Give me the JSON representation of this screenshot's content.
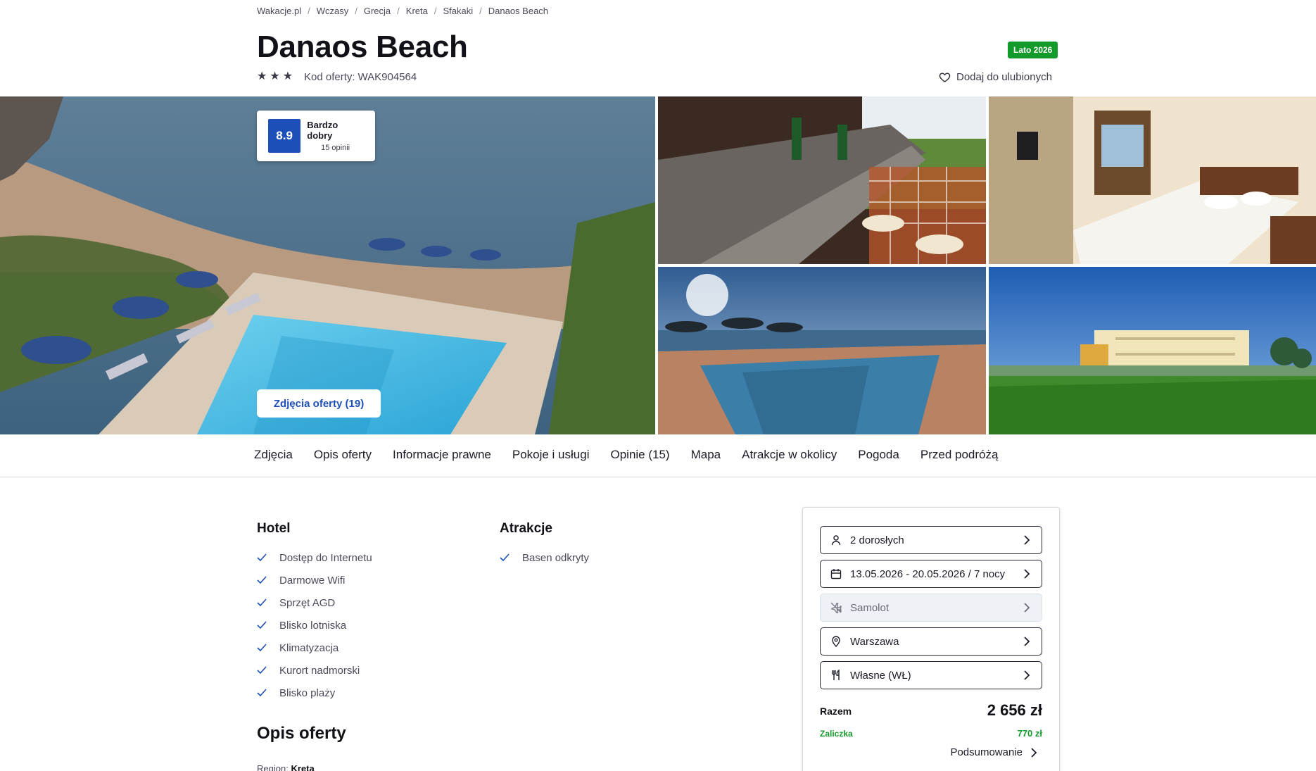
{
  "breadcrumb": [
    "Wakacje.pl",
    "Wczasy",
    "Grecja",
    "Kreta",
    "Sfakaki",
    "Danaos Beach"
  ],
  "breadcrumb_separator": "/",
  "hotel": {
    "name": "Danaos Beach",
    "stars": 3,
    "offer_code_label": "Kod oferty:",
    "offer_code": "WAK904564",
    "season_badge": "Lato 2026",
    "favorite_label": "Dodaj do ulubionych"
  },
  "rating": {
    "score": "8.9",
    "label": "Bardzo dobry",
    "count": "15 opinii"
  },
  "gallery": {
    "photos_button": "Zdjęcia oferty (19)",
    "photos": [
      "pool-beach-aerial",
      "bar-counter-balcony",
      "hotel-room-beds",
      "pool-terrace-sea",
      "hotel-building-exterior"
    ]
  },
  "tabs": [
    "Zdjęcia",
    "Opis oferty",
    "Informacje prawne",
    "Pokoje i usługi",
    "Opinie (15)",
    "Mapa",
    "Atrakcje w okolicy",
    "Pogoda",
    "Przed podróżą"
  ],
  "features": {
    "hotel": {
      "title": "Hotel",
      "items": [
        "Dostęp do Internetu",
        "Darmowe Wifi",
        "Sprzęt AGD",
        "Blisko lotniska",
        "Klimatyzacja",
        "Kurort nadmorski",
        "Blisko plaży"
      ]
    },
    "attractions": {
      "title": "Atrakcje",
      "items": [
        "Basen odkryty"
      ]
    }
  },
  "description": {
    "title": "Opis oferty",
    "region_label": "Region:",
    "region_value": "Kreta"
  },
  "booking": {
    "travelers": "2 dorosłych",
    "dates": "13.05.2026 - 20.05.2026 / 7 nocy",
    "transport": "Samolot",
    "departure": "Warszawa",
    "board": "Własne (WŁ)",
    "total_label": "Razem",
    "total_price": "2 656 zł",
    "deposit_label": "Zaliczka",
    "deposit_price": "770 zł",
    "summary_label": "Podsumowanie"
  },
  "colors": {
    "accent_blue": "#1d4fb8",
    "badge_green": "#129a2a",
    "check_blue": "#1d4fb8"
  }
}
